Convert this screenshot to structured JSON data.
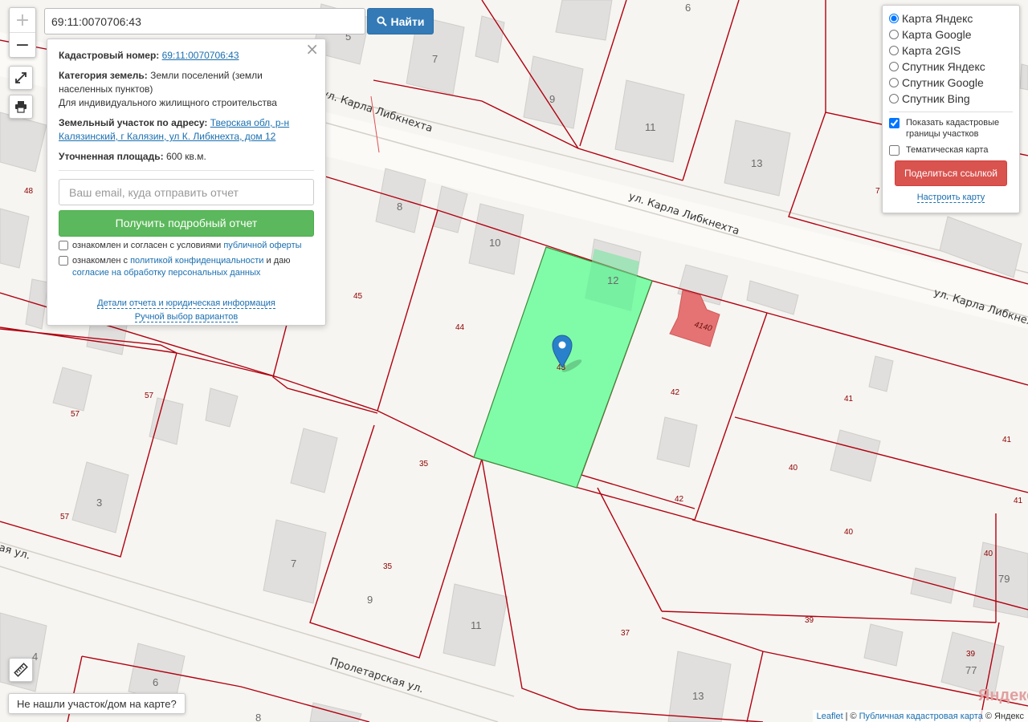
{
  "search": {
    "value": "69:11:0070706:43",
    "button_label": "Найти"
  },
  "controls": {
    "zoom_in": "+",
    "zoom_out": "−"
  },
  "info": {
    "cadastral_label": "Кадастровый номер:",
    "cadastral_value": "69:11:0070706:43",
    "category_label": "Категория земель:",
    "category_value": "Земли поселений (земли населенных пунктов)",
    "category_use": "Для индивидуального жилищного строительства",
    "address_label": "Земельный участок по адресу:",
    "address_value": "Тверская обл, р-н Калязинский, г Калязин, ул К. Либкнехта, дом 12",
    "area_label": "Уточненная площадь:",
    "area_value": "600 кв.м.",
    "email_placeholder": "Ваш email, куда отправить отчет",
    "report_button": "Получить подробный отчет",
    "agree1_prefix": "ознакомлен и согласен с условиями",
    "agree1_link": "публичной оферты",
    "agree2_prefix": "ознакомлен с",
    "agree2_link": "политикой конфиденциальности",
    "agree2_middle": "и даю",
    "agree2_link2": "согласие на обработку персональных данных",
    "details_link": "Детали отчета и юридическая информация",
    "manual_link": "Ручной выбор вариантов"
  },
  "layers": {
    "options": [
      "Карта Яндекс",
      "Карта Google",
      "Карта 2GIS",
      "Спутник Яндекс",
      "Спутник Google",
      "Спутник Bing"
    ],
    "selected_index": 0,
    "show_boundaries": "Показать кадастровые границы участков",
    "show_boundaries_checked": true,
    "thematic": "Тематическая карта",
    "thematic_checked": false,
    "share_button": "Поделиться ссылкой",
    "setup_link": "Настроить карту"
  },
  "notfound_button": "Не нашли участок/дом на карте?",
  "attribution": {
    "leaflet": "Leaflet",
    "sep": "|",
    "copyright": "©",
    "pkk": "Публичная кадастровая карта",
    "yandex": "© Яндекс"
  },
  "logo_text": "Яндекс",
  "map": {
    "streets": [
      "ул. Карла Либкнехта",
      "ул. Карла Либкнехта",
      "ул. Карла Либкнехта",
      "Пролетарская ул.",
      "ая ул."
    ],
    "plot_numbers": [
      "48",
      "45",
      "44",
      "43",
      "42",
      "42",
      "41",
      "41",
      "41",
      "40",
      "40",
      "40",
      "39",
      "39",
      "37",
      "35",
      "35",
      "57",
      "57",
      "57",
      "7"
    ],
    "house_numbers": [
      "5",
      "7",
      "9",
      "11",
      "13",
      "6",
      "8",
      "10",
      "12",
      "3",
      "7",
      "9",
      "11",
      "13",
      "4",
      "6",
      "8",
      "79",
      "77"
    ],
    "building_label": "4140",
    "selected_color": "#80fca8",
    "boundary_color": "#b00010"
  }
}
